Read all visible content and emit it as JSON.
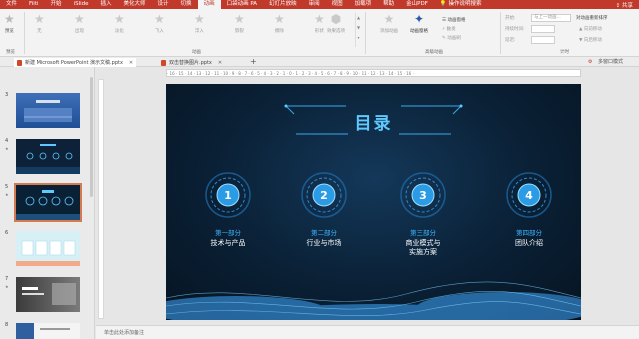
{
  "menu": {
    "items": [
      "文件",
      "Fiiti",
      "开始",
      "iSlide",
      "插入",
      "美化大师",
      "设计",
      "切换",
      "动画",
      "口袋动画 PA",
      "幻灯片放映",
      "审阅",
      "视图",
      "加载项",
      "帮助",
      "金山PDF"
    ],
    "active_index": 8,
    "tellme": "操作说明搜索",
    "share": "共享"
  },
  "ribbon": {
    "preview_label": "预览",
    "effects": [
      "无",
      "出现",
      "淡化",
      "飞入",
      "浮入",
      "劈裂",
      "擦除",
      "形状"
    ],
    "effect_options": "效果选项",
    "add_animation": "添加动画",
    "animation_pane": "动画窗格",
    "trigger": "触发",
    "animation_painter": "动画刷",
    "start_label": "开始:",
    "start_value": "与上一动画...",
    "duration_label": "持续时间:",
    "delay_label": "延迟:",
    "reorder": "对动画重新排序",
    "move_earlier": "向前移动",
    "move_later": "向后移动",
    "group_preview": "预览",
    "group_animation": "动画",
    "group_advanced": "高级动画",
    "group_timing": "计时"
  },
  "tabs": [
    {
      "label": "新建 Microsoft PowerPoint 演示文稿.pptx",
      "active": true
    },
    {
      "label": "双击替换图片.pptx",
      "active": false
    }
  ],
  "tabbar_right": "多窗口模式",
  "thumbnails": [
    {
      "num": "3",
      "star": ""
    },
    {
      "num": "4",
      "star": "★"
    },
    {
      "num": "5",
      "star": "★"
    },
    {
      "num": "6",
      "star": ""
    },
    {
      "num": "7",
      "star": "★"
    },
    {
      "num": "8",
      "star": ""
    }
  ],
  "ruler_text": "· 16 · 15 · 14 · 13 · 12 · 11 · 10 · 9 · 8 · 7 · 6 · 5 · 4 · 3 · 2 · 1 · 0 · 1 · 2 · 3 · 4 · 5 · 6 · 7 · 8 · 9 · 10 · 11 · 12 · 13 · 14 · 15 · 16 ·",
  "slide": {
    "title": "目录",
    "parts": [
      {
        "num": "1",
        "label": "第一部分",
        "title": "技术与产品"
      },
      {
        "num": "2",
        "label": "第二部分",
        "title": "行业与市场"
      },
      {
        "num": "3",
        "label": "第三部分",
        "title": "商业模式与\n实施方案"
      },
      {
        "num": "4",
        "label": "第四部分",
        "title": "团队介绍"
      }
    ]
  },
  "notes_placeholder": "单击此处添加备注",
  "colors": {
    "brand": "#c0392b",
    "accent": "#3fb6ff",
    "slide_bg": "#0a2035"
  }
}
